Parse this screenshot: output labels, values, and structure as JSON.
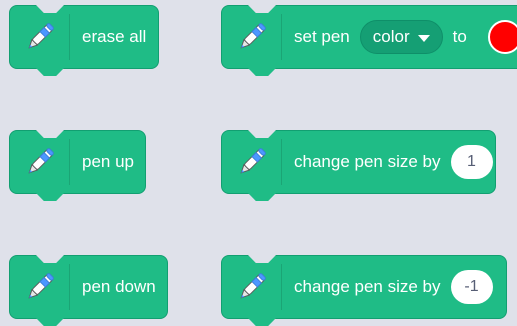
{
  "colors": {
    "background": "#dfe1ea",
    "block_fill": "#1fbc86",
    "block_border": "#129f71",
    "dropdown_fill": "#159f74",
    "swatch_color": "#ff0000",
    "input_text": "#575e75"
  },
  "blocks": {
    "erase_all": {
      "label": "erase all",
      "icon": "pen-icon"
    },
    "set_pen": {
      "label": "set pen",
      "dropdown_value": "color",
      "to_label": "to",
      "swatch_color": "#ff0000",
      "icon": "pen-icon"
    },
    "pen_up": {
      "label": "pen up",
      "icon": "pen-icon"
    },
    "change_size_1": {
      "label": "change pen size by",
      "value": "1",
      "icon": "pen-icon"
    },
    "pen_down": {
      "label": "pen down",
      "icon": "pen-icon"
    },
    "change_size_neg1": {
      "label": "change pen size by",
      "value": "-1",
      "icon": "pen-icon"
    }
  }
}
